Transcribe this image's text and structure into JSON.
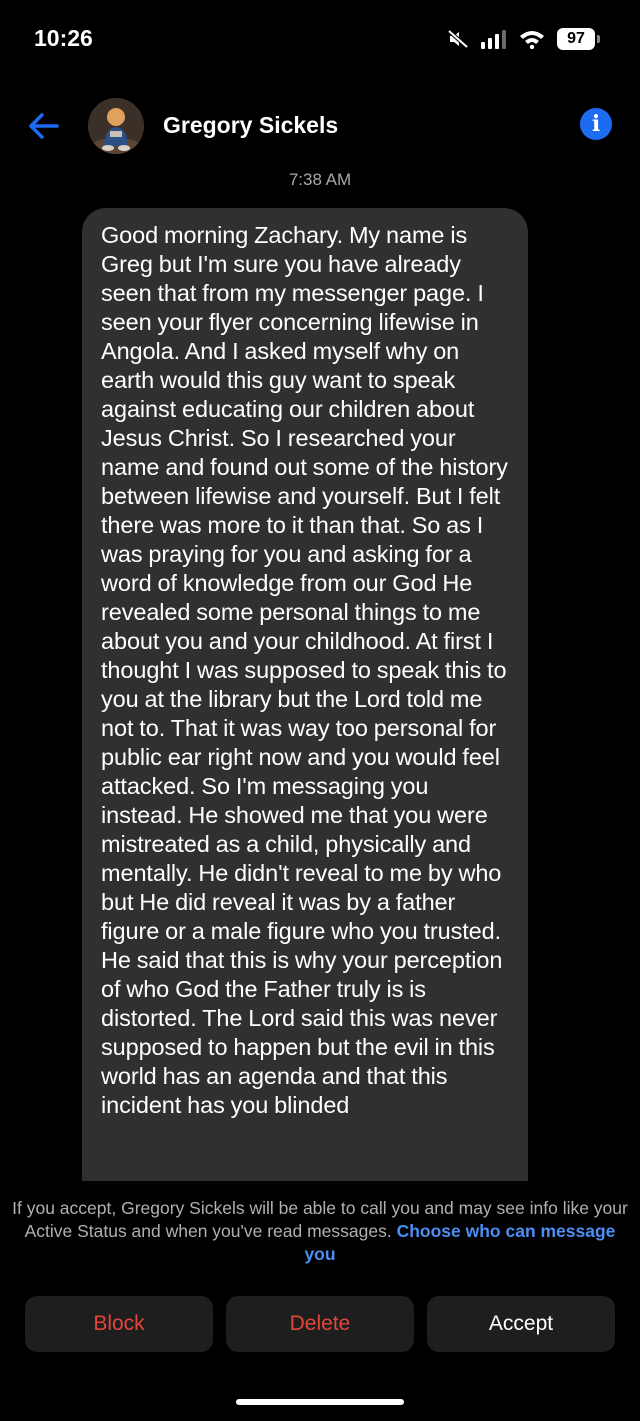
{
  "status_bar": {
    "time": "10:26",
    "battery_level": "97",
    "icons": [
      "mute-icon",
      "signal-icon",
      "wifi-icon",
      "battery-icon"
    ]
  },
  "header": {
    "contact_name": "Gregory Sickels",
    "back_icon": "back-arrow-icon",
    "info_icon": "info-icon",
    "info_glyph": "i"
  },
  "conversation": {
    "timestamp": "7:38 AM",
    "message": "Good morning Zachary. My name is Greg but I'm sure you have already seen that from my messenger page. I seen your flyer concerning lifewise in Angola. And I asked myself why on earth would this guy want to speak against educating our children about Jesus Christ. So I researched your name and found out some of the history between lifewise and yourself. But I felt there was more to it than that. So as I was praying for you and asking for a word of knowledge from our God He revealed some personal things to me about you and your childhood. At first I thought I was supposed to speak this to you at the library but the Lord told me not to. That it was way too personal for public ear right now and you would feel attacked. So I'm messaging you instead. He showed me that you were mistreated as a child, physically and mentally. He didn't reveal to me by who but He did reveal it was by a father figure or a male figure who you trusted. He said that this is why your perception of who God the Father truly is is distorted. The Lord said this was never supposed to happen but the evil in this world has an agenda and that this incident has you blinded"
  },
  "request": {
    "info_text": "If you accept, Gregory Sickels will be able to call you and may see info like your Active Status and when you've read messages. ",
    "link_text": "Choose who can message you",
    "actions": {
      "block": "Block",
      "delete": "Delete",
      "accept": "Accept"
    }
  },
  "colors": {
    "background": "#000000",
    "bubble": "#303030",
    "accent_blue": "#1d6bf0",
    "link_blue": "#4b8ff5",
    "danger_red": "#e2453c",
    "button_bg": "#1e1e1e"
  }
}
